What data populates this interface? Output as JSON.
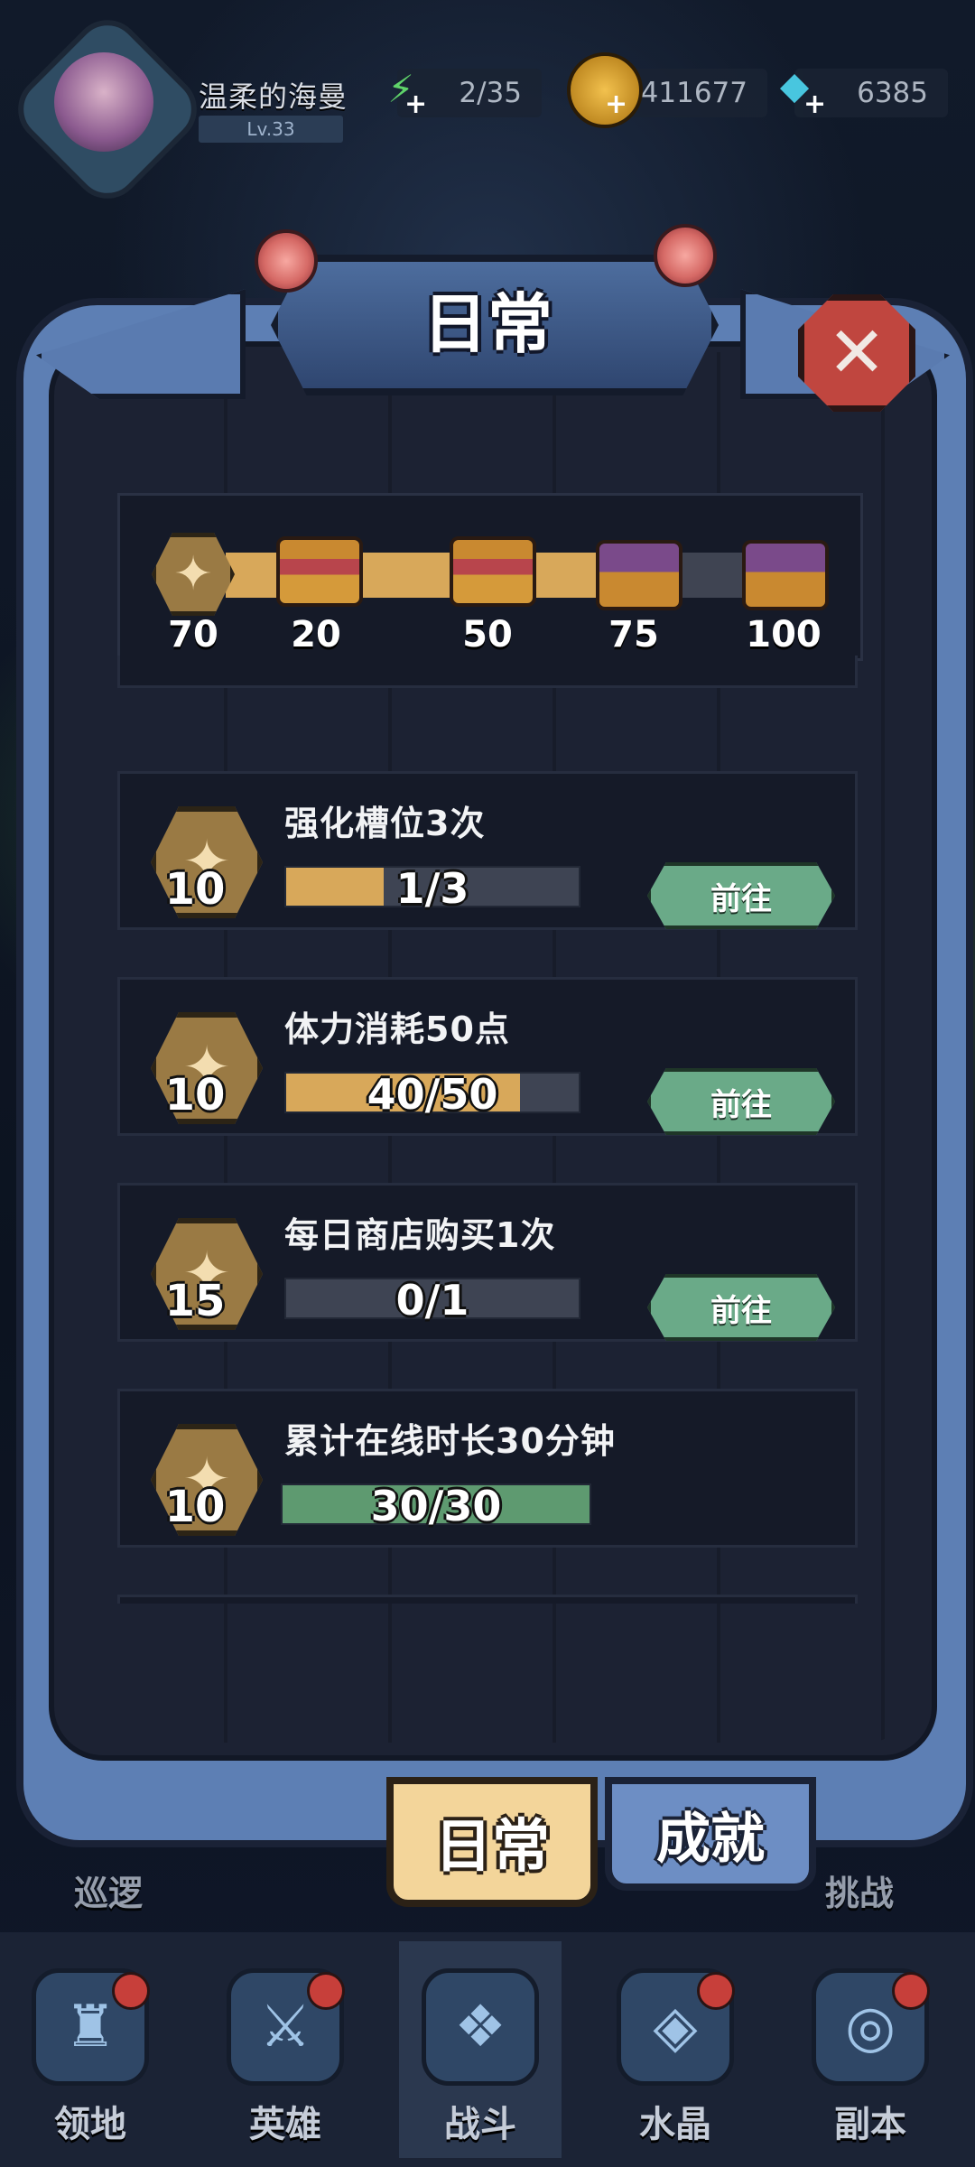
{
  "player": {
    "name": "温柔的海曼",
    "level": "Lv.33"
  },
  "resources": {
    "stamina": "2/35",
    "gold": "1411677",
    "diamond": "6385"
  },
  "panel": {
    "title": "日常"
  },
  "activity": {
    "current": 70,
    "max": 100,
    "milestones": [
      "20",
      "50",
      "75",
      "100"
    ],
    "current_label": "70"
  },
  "tasks": [
    {
      "title": "强化槽位3次",
      "reward": "10",
      "progress_text": "1/3",
      "progress": 0.333,
      "button": "前往",
      "complete": false
    },
    {
      "title": "体力消耗50点",
      "reward": "10",
      "progress_text": "40/50",
      "progress": 0.8,
      "button": "前往",
      "complete": false
    },
    {
      "title": "每日商店购买1次",
      "reward": "15",
      "progress_text": "0/1",
      "progress": 0,
      "button": "前往",
      "complete": false
    },
    {
      "title": "累计在线时长30分钟",
      "reward": "10",
      "progress_text": "30/30",
      "progress": 1,
      "button": "",
      "complete": true
    }
  ],
  "tabs": {
    "daily": "日常",
    "achievement": "成就"
  },
  "background_labels": {
    "left": "巡逻",
    "right": "挑战"
  },
  "nav": [
    {
      "label": "领地",
      "icon": "castle-icon"
    },
    {
      "label": "英雄",
      "icon": "hero-icon"
    },
    {
      "label": "战斗",
      "icon": "battle-icon"
    },
    {
      "label": "水晶",
      "icon": "crystal-icon"
    },
    {
      "label": "副本",
      "icon": "dungeon-icon"
    }
  ],
  "colors": {
    "progress_fill": "#d8a85a",
    "complete_fill": "#5e9a70",
    "go_button": "#6aaa88",
    "close_button": "#c0463f"
  }
}
